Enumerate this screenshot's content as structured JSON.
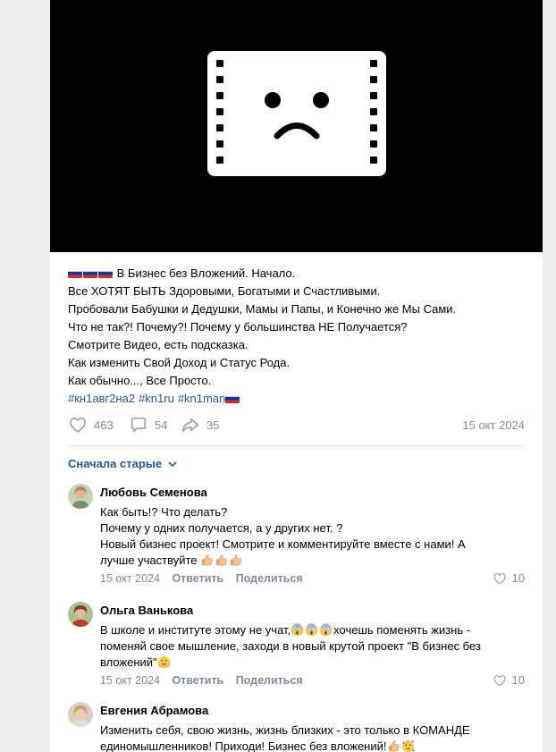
{
  "post": {
    "text_lines": [
      "В Бизнес без Вложений. Начало.",
      "Все ХОТЯТ БЫТЬ Здоровыми, Богатыми и Счастливыми.",
      "Пробовали Бабушки и Дедушки, Мамы и Папы, и Конечно же Мы Сами.",
      "Что не так?! Почему?! Почему у большинства НЕ Получается?",
      "Смотрите Видео, есть подсказка.",
      "Как изменить Свой Доход и Статус Рода.",
      "Как обычно..., Все Просто."
    ],
    "hashtags": [
      "#кн1авг2на2",
      "#kn1ru",
      "#kn1man"
    ],
    "likes": "463",
    "comments": "54",
    "shares": "35",
    "date": "15 окт 2024"
  },
  "comments_sort": "Сначала старые",
  "comments": [
    {
      "author": "Любовь Семенова",
      "lines": [
        "Как быть!? Что делать?",
        "Почему у одних получается, а у других нет. ?",
        "Новый бизнес проект! Смотрите и комментируйте вместе с нами! А",
        "лучше участвуйте"
      ],
      "date": "15 окт 2024",
      "reply": "Ответить",
      "share": "Поделиться",
      "likes": "10"
    },
    {
      "author": "Ольга Ванькова",
      "lines": [
        "В школе и институте этому не учат,",
        "хочешь поменять жизнь -",
        "поменяй свое мышление, заходи в новый крутой проект \"В бизнес без",
        "вложений\""
      ],
      "date": "15 окт 2024",
      "reply": "Ответить",
      "share": "Поделиться",
      "likes": "10"
    },
    {
      "author": "Евгения Абрамова",
      "lines": [
        "Изменить себя, свою жизнь, жизнь близких - это только в КОМАНДЕ",
        "единомышленников! Приходи! Бизнес без вложений!"
      ]
    }
  ],
  "colors": {
    "link": "#2a5885",
    "secondary": "#818c99",
    "page_bg": "#edeef0"
  },
  "icons": [
    "sad-video-unavailable-icon",
    "heart-icon",
    "comment-icon",
    "share-icon",
    "chevron-down-icon"
  ]
}
